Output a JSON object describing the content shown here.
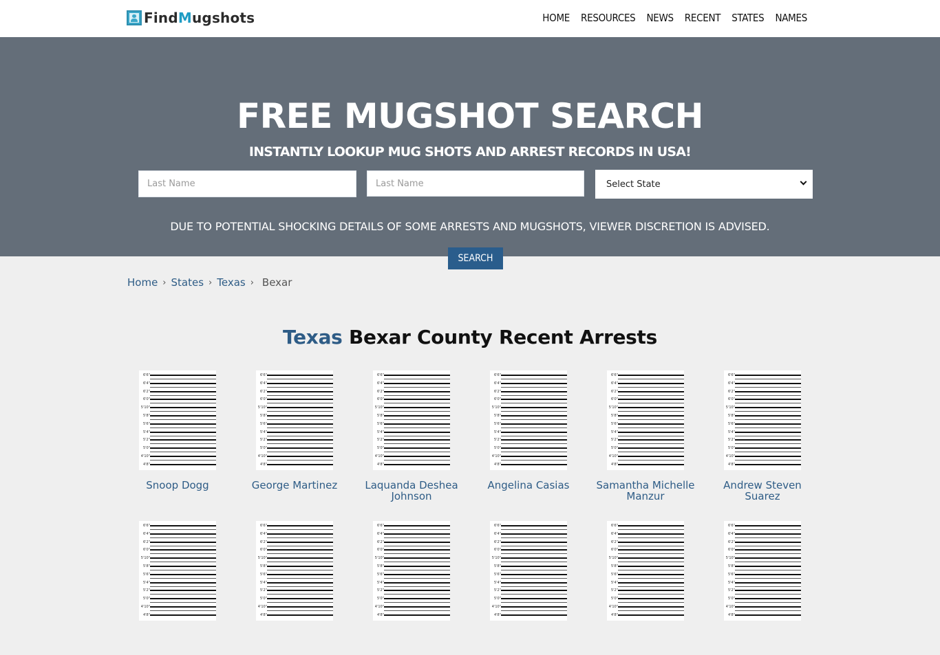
{
  "header": {
    "logo": {
      "part1": "Find",
      "part2": "M",
      "part3": "ugshots",
      "icon": "mugshot-card-icon"
    },
    "nav": [
      "HOME",
      "RESOURCES",
      "NEWS",
      "RECENT",
      "STATES",
      "NAMES"
    ]
  },
  "hero": {
    "title": "FREE MUGSHOT SEARCH",
    "subtitle": "INSTANTLY LOOKUP MUG SHOTS AND ARREST RECORDS IN USA!",
    "first_input": {
      "placeholder": "Last Name",
      "value": ""
    },
    "second_input": {
      "placeholder": "Last Name",
      "value": ""
    },
    "state_select": {
      "selected": "Select State"
    },
    "notice": "DUE TO POTENTIAL SHOCKING DETAILS OF SOME ARRESTS AND MUGSHOTS, VIEWER DISCRETION IS ADVISED.",
    "search_label": "SEARCH"
  },
  "breadcrumb": {
    "items": [
      "Home",
      "States",
      "Texas"
    ],
    "current": "Bexar",
    "separator": "›"
  },
  "section": {
    "title_state": "Texas",
    "title_rest": " Bexar County Recent Arrests"
  },
  "height_chart_labels": [
    "6'6\"",
    "6'4\"",
    "6'2\"",
    "6'0\"",
    "5'10\"",
    "5'8\"",
    "5'6\"",
    "5'4\"",
    "5'2\"",
    "5'0\"",
    "4'10\"",
    "4'8\""
  ],
  "arrests": [
    {
      "name": "Snoop Dogg"
    },
    {
      "name": "George Martinez"
    },
    {
      "name": "Laquanda Deshea Johnson"
    },
    {
      "name": "Angelina Casias"
    },
    {
      "name": "Samantha Michelle Manzur"
    },
    {
      "name": "Andrew Steven Suarez"
    },
    {
      "name": ""
    },
    {
      "name": ""
    },
    {
      "name": ""
    },
    {
      "name": ""
    },
    {
      "name": ""
    },
    {
      "name": ""
    }
  ],
  "colors": {
    "hero_bg": "#646e79",
    "accent_blue": "#2e5c86",
    "button_blue": "#2a5d8c",
    "logo_cyan": "#1f9cc4"
  }
}
